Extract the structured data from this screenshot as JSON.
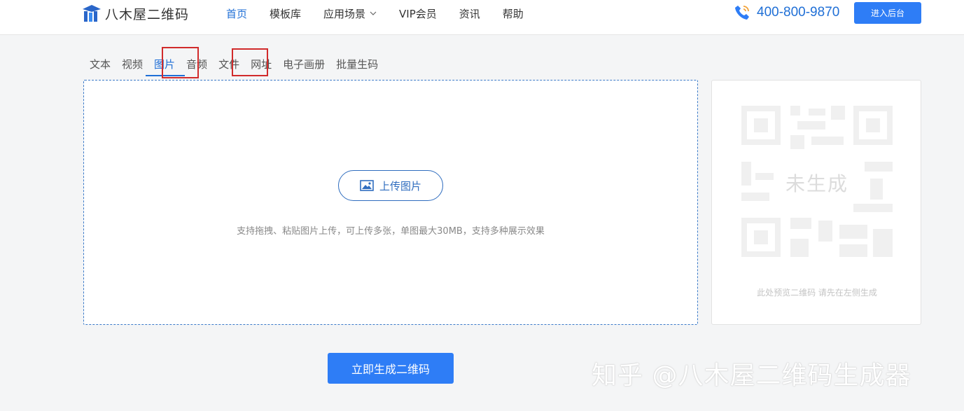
{
  "header": {
    "logo_text": "八木屋二维码",
    "nav": [
      {
        "label": "首页",
        "active": true
      },
      {
        "label": "模板库"
      },
      {
        "label": "应用场景",
        "dropdown": true
      },
      {
        "label": "VIP会员"
      },
      {
        "label": "资讯"
      },
      {
        "label": "帮助"
      }
    ],
    "phone": "400-800-9870",
    "admin_button": "进入后台"
  },
  "tabs": [
    {
      "label": "文本"
    },
    {
      "label": "视频"
    },
    {
      "label": "图片",
      "active": true
    },
    {
      "label": "音频"
    },
    {
      "label": "文件"
    },
    {
      "label": "网址"
    },
    {
      "label": "电子画册"
    },
    {
      "label": "批量生码"
    }
  ],
  "upload": {
    "button_label": "上传图片",
    "tip": "支持拖拽、粘贴图片上传，可上传多张，单图最大30MB，支持多种展示效果"
  },
  "preview": {
    "qr_overlay": "未生成",
    "tip": "此处预览二维码 请先在左侧生成"
  },
  "generate_button": "立即生成二维码",
  "watermark": "知乎 @八木屋二维码生成器",
  "colors": {
    "accent": "#2e7df6",
    "link": "#1f6fd6",
    "highlight": "#d12b2b"
  }
}
